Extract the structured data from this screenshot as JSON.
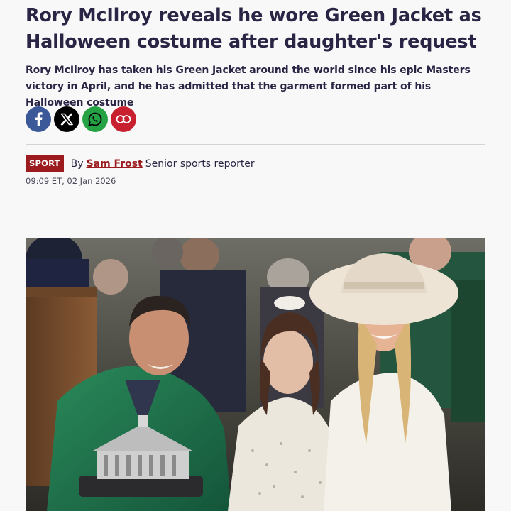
{
  "article": {
    "headline": "Rory McIlroy reveals he wore Green Jacket as Halloween costume after daughter's request",
    "standfirst": "Rory McIlroy has taken his Green Jacket around the world since his epic Masters victory in April, and he has admitted that the garment formed part of his Halloween costume",
    "section_badge": "SPORT",
    "by_prefix": "By",
    "author_name": "Sam Frost",
    "author_role": "Senior sports reporter",
    "timestamp": "09:09 ET, 02 Jan 2026"
  },
  "share": [
    {
      "icon": "facebook-icon",
      "color": "#3b5998"
    },
    {
      "icon": "x-icon",
      "color": "#000000"
    },
    {
      "icon": "whatsapp-icon",
      "color": "#25a244"
    },
    {
      "icon": "link-icon",
      "color": "#c8202f"
    }
  ],
  "colors": {
    "headline": "#2b2545",
    "badge": "#9b1b1e",
    "author_link": "#9b1b1e",
    "green_jacket": "#1f6b45"
  }
}
